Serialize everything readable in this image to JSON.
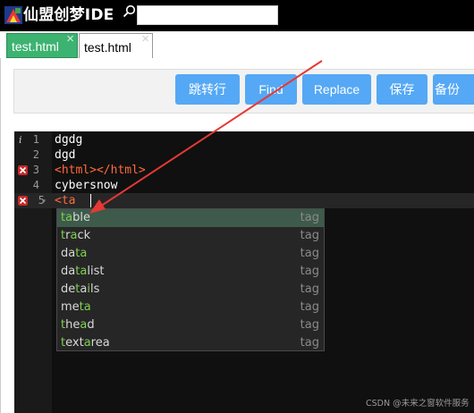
{
  "app": {
    "title": "仙盟创梦IDE",
    "search_value": "",
    "search_placeholder": ""
  },
  "tabs": [
    {
      "label": "test.html",
      "active": true,
      "close": "×"
    },
    {
      "label": "test.html",
      "active": false,
      "close": "×"
    }
  ],
  "toolbar": {
    "goto_label": "跳转行",
    "find_label": "Find",
    "replace_label": "Replace",
    "save_label": "保存",
    "backup_label": "备份"
  },
  "editor": {
    "lines": [
      {
        "num": "1",
        "text": "dgdg",
        "marker": "info"
      },
      {
        "num": "2",
        "text": "dgd",
        "marker": ""
      },
      {
        "num": "3",
        "text": "<html></html>",
        "marker": "error"
      },
      {
        "num": "4",
        "text": "cybersnow",
        "marker": ""
      },
      {
        "num": "5",
        "text": "<ta",
        "marker": "error"
      }
    ],
    "info_marker_glyph": "i",
    "fold_glyph": "▾"
  },
  "autocomplete": {
    "items": [
      {
        "word": "table",
        "type": "tag"
      },
      {
        "word": "track",
        "type": "tag"
      },
      {
        "word": "data",
        "type": "tag"
      },
      {
        "word": "datalist",
        "type": "tag"
      },
      {
        "word": "details",
        "type": "tag"
      },
      {
        "word": "meta",
        "type": "tag"
      },
      {
        "word": "thead",
        "type": "tag"
      },
      {
        "word": "textarea",
        "type": "tag"
      }
    ],
    "selected_index": 0
  },
  "watermark": "CSDN @未来之窗软件服务",
  "colors": {
    "title_bar": "#000000",
    "active_tab": "#3cb371",
    "toolbar_button": "#55a8f5",
    "editor_bg": "#101010",
    "error_marker": "#c62828",
    "annotation_arrow": "#e53935",
    "match_highlight": "#7fd150"
  }
}
